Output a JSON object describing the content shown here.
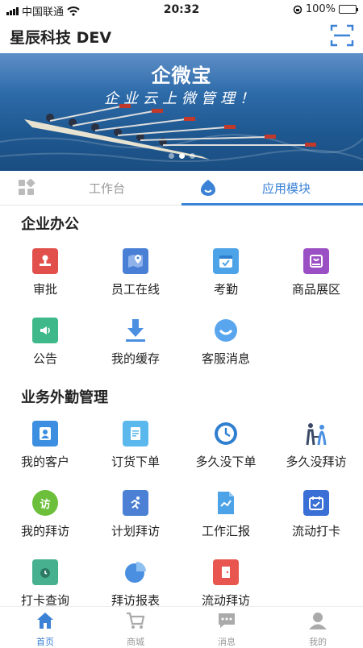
{
  "status_bar": {
    "carrier": "中国联通",
    "time": "20:32",
    "battery": "100%"
  },
  "header": {
    "title": "星辰科技 DEV"
  },
  "banner": {
    "logo": "企微宝",
    "slogan": "企业云上微管理！"
  },
  "tabs": [
    {
      "label": "工作台"
    },
    {
      "label": "应用模块"
    }
  ],
  "sections": [
    {
      "title": "企业办公",
      "items": [
        {
          "label": "审批",
          "icon": "stamp-icon",
          "color": "#e2504b"
        },
        {
          "label": "员工在线",
          "icon": "map-icon",
          "color": "#4a7fd6"
        },
        {
          "label": "考勤",
          "icon": "calendar-check-icon",
          "color": "#4da3e8"
        },
        {
          "label": "商品展区",
          "icon": "shopping-bag-icon",
          "color": "#9b4fc4"
        },
        {
          "label": "公告",
          "icon": "megaphone-icon",
          "color": "#3fb98a"
        },
        {
          "label": "我的缓存",
          "icon": "download-icon",
          "color": "#4a8fe0"
        },
        {
          "label": "客服消息",
          "icon": "chat-smile-icon",
          "color": "#5aa6ee"
        }
      ]
    },
    {
      "title": "业务外勤管理",
      "items": [
        {
          "label": "我的客户",
          "icon": "customer-icon",
          "color": "#3b8ee0"
        },
        {
          "label": "订货下单",
          "icon": "order-icon",
          "color": "#5ab8ec"
        },
        {
          "label": "多久没下单",
          "icon": "clock-icon",
          "color": "#2f7fd0"
        },
        {
          "label": "多久没拜访",
          "icon": "visitors-icon",
          "color": "#3a4a66"
        },
        {
          "label": "我的拜访",
          "icon": "visit-badge-icon",
          "color": "#6bbf3a",
          "badge": "访"
        },
        {
          "label": "计划拜访",
          "icon": "runner-icon",
          "color": "#4b80d4"
        },
        {
          "label": "工作汇报",
          "icon": "report-icon",
          "color": "#4da3e8"
        },
        {
          "label": "流动打卡",
          "icon": "calendar-check-icon",
          "color": "#3a6fd6"
        },
        {
          "label": "打卡查询",
          "icon": "clock-calendar-icon",
          "color": "#46b08f"
        },
        {
          "label": "拜访报表",
          "icon": "pie-chart-icon",
          "color": "#4a8fe0"
        },
        {
          "label": "流动拜访",
          "icon": "door-icon",
          "color": "#e8564f"
        }
      ]
    }
  ],
  "tabbar": [
    {
      "label": "首页",
      "icon": "home-icon",
      "active": true
    },
    {
      "label": "商城",
      "icon": "cart-icon",
      "active": false
    },
    {
      "label": "消息",
      "icon": "message-icon",
      "active": false
    },
    {
      "label": "我的",
      "icon": "user-icon",
      "active": false
    }
  ],
  "colors": {
    "accent": "#3b82d6",
    "inactive": "#999999"
  }
}
